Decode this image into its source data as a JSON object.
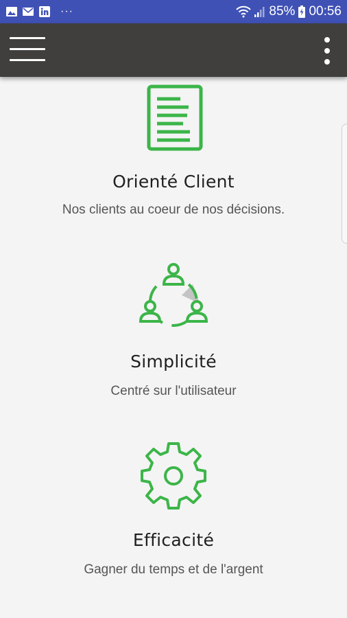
{
  "status_bar": {
    "notification_icons": [
      "gallery-icon",
      "email-icon",
      "linkedin-icon"
    ],
    "overflow_dots": "···",
    "battery": "85%",
    "time": "00:56"
  },
  "app_bar": {
    "menu_icon": "hamburger-menu-icon",
    "more_icon": "more-vert-icon"
  },
  "features": [
    {
      "icon": "document-icon",
      "title": "Orienté Client",
      "subtitle": "Nos clients au coeur de nos décisions."
    },
    {
      "icon": "people-cycle-icon",
      "title": "Simplicité",
      "subtitle": "Centré sur l'utilisateur"
    },
    {
      "icon": "gear-icon",
      "title": "Efficacité",
      "subtitle": "Gagner du temps et de l'argent"
    }
  ],
  "colors": {
    "status_bar": "#3f51b5",
    "app_bar": "#403f3d",
    "accent_green": "#3cb549",
    "background": "#f4f4f4"
  }
}
